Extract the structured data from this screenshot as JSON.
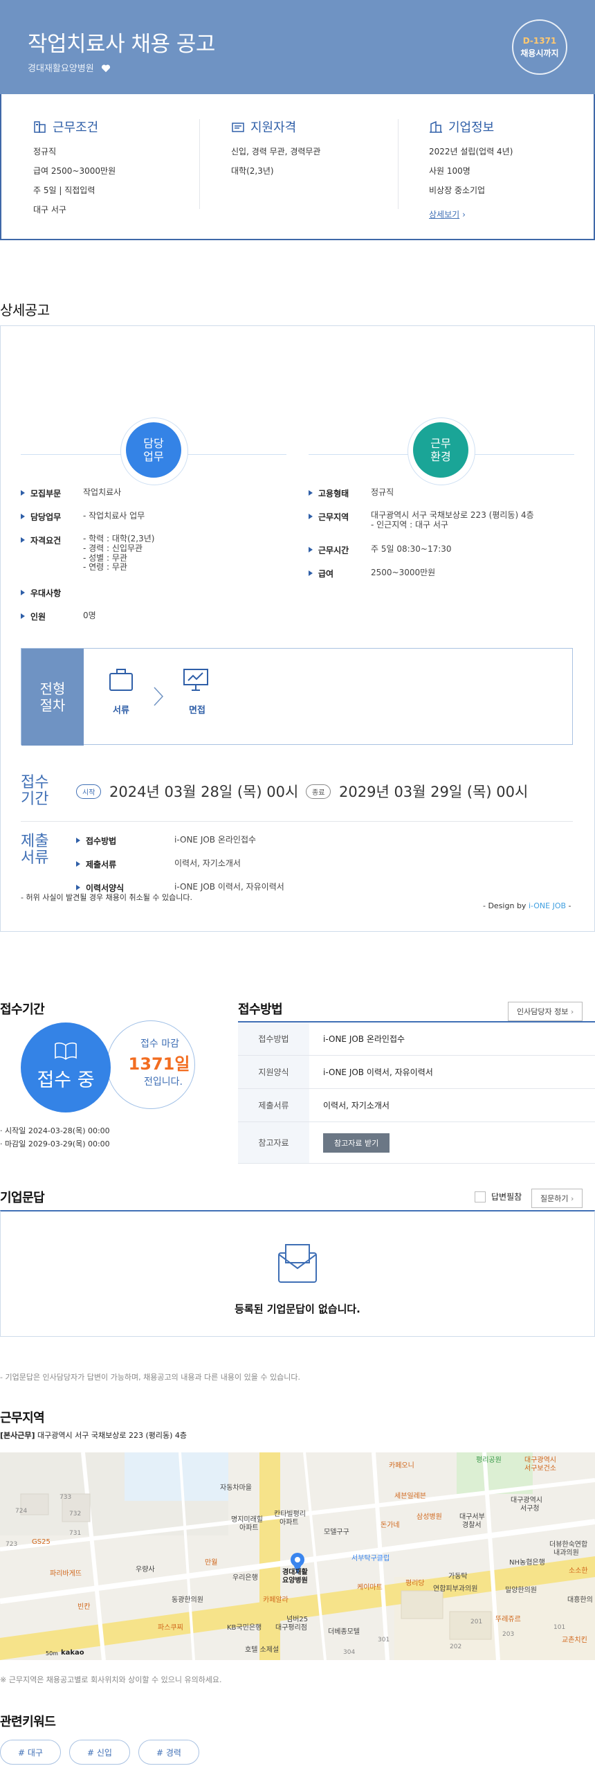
{
  "header": {
    "title": "작업치료사 채용 공고",
    "company": "경대재활요양병원",
    "dday_label": "D-1371",
    "dday_status": "채용시까지"
  },
  "summary": {
    "work": {
      "title": "근무조건",
      "rows": [
        "정규직",
        "급여 2500~3000만원",
        "주 5일 | 직접입력",
        "대구 서구"
      ]
    },
    "qual": {
      "title": "지원자격",
      "rows": [
        "신입, 경력 무관, 경력무관",
        "대학(2,3년)"
      ]
    },
    "company": {
      "title": "기업정보",
      "rows": [
        "2022년 설립(업력 4년)",
        "사원 100명",
        "비상장 중소기업"
      ],
      "more": "상세보기"
    }
  },
  "detail": {
    "title": "상세공고",
    "duty_circle": "담당\n업무",
    "env_circle": "근무\n환경",
    "left": [
      {
        "k": "모집부문",
        "v": "작업치료사"
      },
      {
        "k": "담당업무",
        "v": "- 작업치료사 업무"
      },
      {
        "k": "자격요건",
        "v": "- 학력 : 대학(2,3년)\n- 경력 : 신입무관\n- 성별 : 무관\n- 연령 : 무관"
      },
      {
        "k": "우대사항",
        "v": ""
      },
      {
        "k": "인원",
        "v": "0명"
      }
    ],
    "right": [
      {
        "k": "고용형태",
        "v": "정규직"
      },
      {
        "k": "근무지역",
        "v": "대구광역시 서구 국채보상로 223 (평리동) 4층\n- 인근지역 : 대구 서구"
      },
      {
        "k": "근무시간",
        "v": "주 5일 08:30~17:30"
      },
      {
        "k": "급여",
        "v": "2500~3000만원"
      }
    ],
    "process": {
      "title": "전형\n절차",
      "steps": [
        "서류",
        "면접"
      ]
    },
    "receipt": {
      "title": "접수\n기간",
      "start_pill": "시작",
      "start": "2024년 03월 28일 (목) 00시",
      "end_pill": "종료",
      "end": "2029년 03월 29일 (목) 00시"
    },
    "submit": {
      "title": "제출\n서류",
      "rows": [
        {
          "k": "접수방법",
          "v": "i-ONE JOB 온라인접수"
        },
        {
          "k": "제출서류",
          "v": "이력서, 자기소개서"
        },
        {
          "k": "이력서양식",
          "v": "i-ONE JOB 이력서, 자유이력서"
        }
      ]
    },
    "notice": "- 허위 사실이 발견될 경우 채용이 취소될 수 있습니다.",
    "design_prefix": "- Design by ",
    "design_brand": "i-ONE JOB",
    "design_suffix": " -"
  },
  "period": {
    "title": "접수기간",
    "status": "접수 중",
    "deadline_top": "접수 마감",
    "days": "1371일",
    "deadline_bottom": "전입니다.",
    "start": "시작일 2024-03-28(목) 00:00",
    "end": "마감일 2029-03-29(목) 00:00"
  },
  "method": {
    "title": "접수방법",
    "contact_btn": "인사담당자 정보",
    "rows": [
      {
        "k": "접수방법",
        "v": "i-ONE JOB 온라인접수"
      },
      {
        "k": "지원양식",
        "v": "i-ONE JOB 이력서, 자유이력서"
      },
      {
        "k": "제출서류",
        "v": "이력서, 자기소개서"
      },
      {
        "k": "참고자료",
        "v": "참고자료 받기"
      }
    ]
  },
  "qa": {
    "title": "기업문답",
    "checkbox_label": "답변필참",
    "ask_btn": "질문하기",
    "empty": "등록된 기업문답이 없습니다.",
    "note": "- 기업문답은 인사담당자가 답변이 가능하며, 채용공고의 내용과 다른 내용이 있을 수 있습니다."
  },
  "location": {
    "title": "근무지역",
    "tag": "[본사근무]",
    "address": "대구광역시 서구 국채보상로 223 (평리동) 4층",
    "note": "※ 근무지역은 채용공고별로 회사위치와 상이할 수 있으니 유의하세요.",
    "map_labels": [
      "자동차마을",
      "명지미래힐",
      "아파트",
      "칸타빌평리",
      "아파트",
      "모델구구",
      "삼성병원",
      "대구서부",
      "경찰서",
      "대구광역시",
      "서구청",
      "세븐일레븐",
      "카페오니",
      "우리은행",
      "경대재활",
      "요양병원",
      "서부탁구클럽",
      "동광한의원",
      "KB국민은행",
      "넘버25",
      "대구평리점",
      "호텔 소제설",
      "더베종모텔",
      "케이마트",
      "평리당",
      "가동탁",
      "연합피부과의원",
      "밀양한의원",
      "NH농협은행",
      "더뷰한숙연합",
      "내과의원",
      "대흥한의",
      "파리바게뜨",
      "빈칸",
      "우량사",
      "만월",
      "카페알라",
      "돈가네",
      "뚜레쥬르",
      "교촌치킨",
      "소소한",
      "파스쿠찌",
      "평리공원",
      "대구광역시",
      "서구보건소",
      "733",
      "732",
      "731",
      "724",
      "723",
      "201",
      "202",
      "203",
      "301",
      "304",
      "101",
      "GS25",
      "50m",
      "kakao"
    ]
  },
  "keywords": {
    "title": "관련키워드",
    "items": [
      "# 대구",
      "# 신입",
      "# 경력"
    ]
  },
  "colors": {
    "primary": "#3f6fb5",
    "hero": "#6f93c3",
    "accent_orange": "#f26d21",
    "teal": "#1aa597",
    "blue_circle": "#3483e6"
  }
}
